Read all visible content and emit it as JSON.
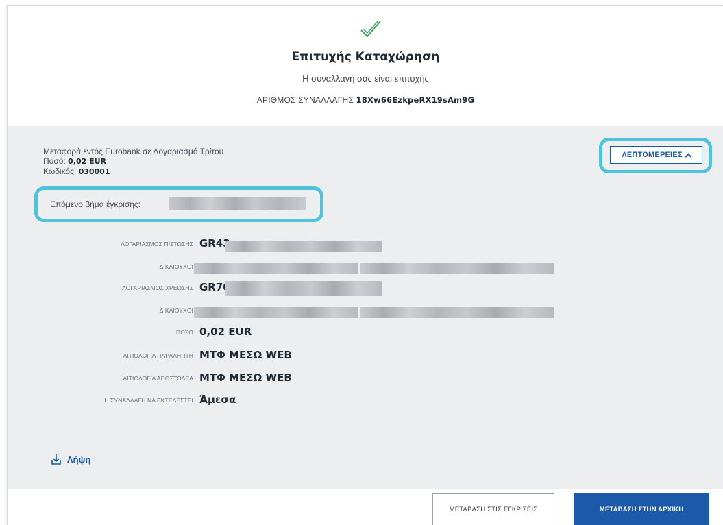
{
  "header": {
    "title": "Επιτυχής Καταχώρηση",
    "subtitle": "Η συναλλαγή σας είναι επιτυχής",
    "txn_label": "ΑΡΙΘΜΟΣ ΣΥΝΑΛΛΑΓΗΣ",
    "txn_id": "18Xw66EzkpeRX19sAm9G"
  },
  "summary": {
    "description": "Μεταφορά εντός Eurobank σε Λογαριασμό Τρίτου",
    "amount_label": "Ποσό:",
    "amount_value": "0,02 EUR",
    "code_label": "Κωδικός:",
    "code_value": "030001",
    "details_label": "ΛΕΠΤΟΜΕΡΕΙΕΣ",
    "next_step_label": "Επόμενο βήμα έγκρισης:"
  },
  "rows": [
    {
      "label": "ΛΟΓΑΡΙΑΣΜΟΣ ΠΙΣΤΩΣΗΣ",
      "value": "GR43"
    },
    {
      "label": "ΔΙΚΑΙΟΥΧΟΙ",
      "value": ""
    },
    {
      "label": "ΛΟΓΑΡΙΑΣΜΟΣ ΧΡΕΩΣΗΣ",
      "value": "GR70"
    },
    {
      "label": "ΔΙΚΑΙΟΥΧΟΙ",
      "value": ""
    },
    {
      "label": "ΠΟΣΟ",
      "value": "0,02 EUR"
    },
    {
      "label": "ΑΙΤΙΟΛΟΓΙΑ ΠΑΡΑΛΗΠΤΗ",
      "value": "ΜΤΦ ΜΕΣΩ WEB"
    },
    {
      "label": "ΑΙΤΙΟΛΟΓΙΑ ΑΠΟΣΤΟΛΕΑ",
      "value": "ΜΤΦ ΜΕΣΩ WEB"
    },
    {
      "label": "Η ΣΥΝΑΛΛΑΓΗ ΝΑ ΕΚΤΕΛΕΣΤΕΙ",
      "value": "Άμεσα"
    }
  ],
  "download_label": "Λήψη",
  "buttons": {
    "approvals": "ΜΕΤΑΒΑΣΗ ΣΤΙΣ ΕΓΚΡΙΣΕΙΣ",
    "home": "ΜΕΤΑΒΑΣΗ ΣΤΗΝ ΑΡΧΙΚΗ"
  },
  "colors": {
    "brand_blue": "#1a5aa8",
    "success_green": "#3aa05a",
    "highlight": "#4ec3d9",
    "panel_bg": "#eceef0"
  }
}
